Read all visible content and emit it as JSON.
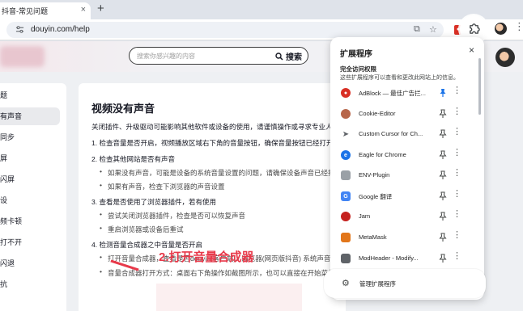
{
  "browser": {
    "tab_title": "抖音-常见问题",
    "tab_close": "×",
    "new_tab": "+",
    "url": "douyin.com/help",
    "menu": "⋮"
  },
  "page": {
    "search_placeholder": "搜索你感兴趣的内容",
    "search_button": "搜索",
    "sidebar": [
      "题",
      "有声音",
      "同步",
      "屏",
      "闪屏",
      "设",
      "频卡顿",
      "打不开",
      "闪退",
      "抗"
    ],
    "article": {
      "title": "视频没有声音",
      "intro": "关闭插件、升级驱动可能影响其他软件或设备的使用，请谨慎操作或寻求专业人士",
      "s1": "1. 检查音量是否开启，视频播放区域右下角的音量按钮，确保音量按钮已经打开",
      "s2": "2. 检查其他网站是否有声音",
      "s2a": "如果没有声音，可能是设备的系统音量设置的问题，请确保设备声音已经打开",
      "s2b": "如果有声音，检查下浏览器的声音设置",
      "s3": "3. 查看是否使用了浏览器插件，若有使用",
      "s3a": "尝试关闭浏览器插件，检查是否可以恢复声音",
      "s3b": "重启浏览器或设备后重试",
      "s4": "4. 检测音量合成器之中音量是否开启",
      "s4a": "打开音量合成器，查看是否douyin(客户端) / 浏览器(网页版抖音) 系统声音关",
      "s4b": "音量合成器打开方式：桌面右下角操作如截图所示，也可以直接在开始菜单搜",
      "banner": "2.打开音量合成器"
    }
  },
  "extensions_popup": {
    "title": "扩展程序",
    "close": "×",
    "section_title": "完全访问权限",
    "section_desc": "这些扩展程序可以查看和更改此网站上的信息。",
    "items": [
      {
        "name": "AdBlock — 最佳广告拦...",
        "pinned": true,
        "icon": "adblock-icon",
        "color": "#d93025"
      },
      {
        "name": "Cookie-Editor",
        "pinned": false,
        "icon": "cookie-icon",
        "color": "#b7664a"
      },
      {
        "name": "Custom Cursor for Ch...",
        "pinned": false,
        "icon": "cursor-icon",
        "color": "#5f6368"
      },
      {
        "name": "Eagle for Chrome",
        "pinned": false,
        "icon": "eagle-icon",
        "color": "#1a73e8"
      },
      {
        "name": "ENV-Plugin",
        "pinned": false,
        "icon": "env-plugin-icon",
        "color": "#9aa0a6"
      },
      {
        "name": "Google 翻译",
        "pinned": false,
        "icon": "google-translate-icon",
        "color": "#4285f4"
      },
      {
        "name": "Jam",
        "pinned": false,
        "icon": "jam-icon",
        "color": "#c5221f"
      },
      {
        "name": "MetaMask",
        "pinned": false,
        "icon": "metamask-icon",
        "color": "#e2761b"
      },
      {
        "name": "ModHeader - Modify...",
        "pinned": false,
        "icon": "modheader-icon",
        "color": "#5f6368"
      }
    ],
    "manage": "管理扩展程序"
  }
}
